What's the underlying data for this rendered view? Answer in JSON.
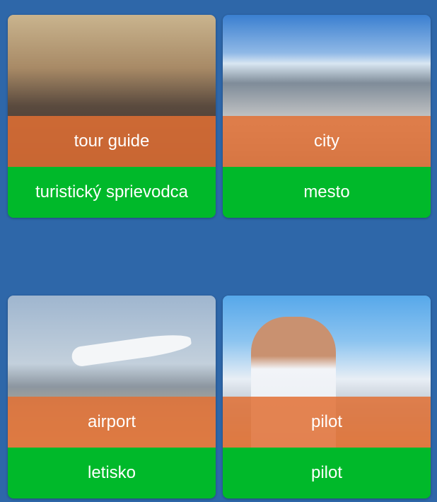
{
  "cards": [
    {
      "english": "tour guide",
      "slovak": "turistický sprievodca",
      "image": "tour-group-photo"
    },
    {
      "english": "city",
      "slovak": "mesto",
      "image": "city-skyline-photo"
    },
    {
      "english": "airport",
      "slovak": "letisko",
      "image": "airplane-takeoff-photo"
    },
    {
      "english": "pilot",
      "slovak": "pilot",
      "image": "pilot-photo"
    }
  ],
  "colors": {
    "background": "#2e67a9",
    "overlay": "#e27034",
    "translation": "#00b92a"
  }
}
